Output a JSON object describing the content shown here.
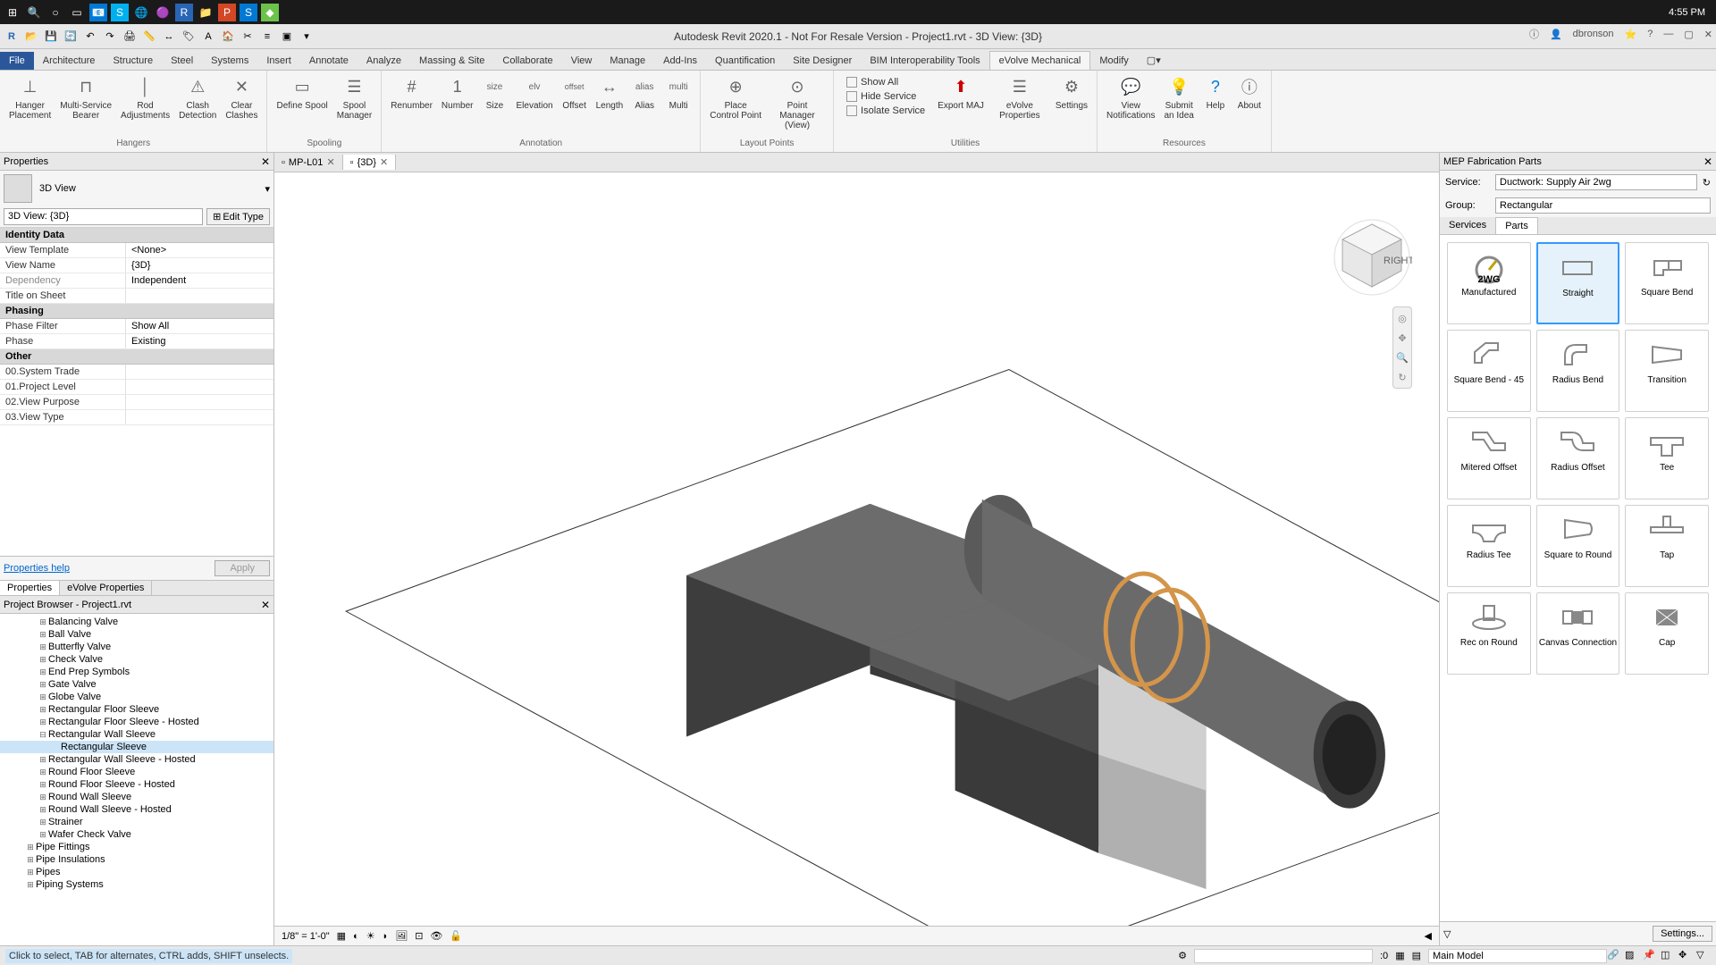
{
  "taskbar": {
    "time": "4:55 PM"
  },
  "app": {
    "title": "Autodesk Revit 2020.1 - Not For Resale Version - Project1.rvt - 3D View: {3D}",
    "user": "dbronson"
  },
  "ribbon": {
    "tabs": [
      "File",
      "Architecture",
      "Structure",
      "Steel",
      "Systems",
      "Insert",
      "Annotate",
      "Analyze",
      "Massing & Site",
      "Collaborate",
      "View",
      "Manage",
      "Add-Ins",
      "Quantification",
      "Site Designer",
      "BIM Interoperability Tools",
      "eVolve Mechanical",
      "Modify"
    ],
    "active_tab": "eVolve Mechanical",
    "groups": {
      "hangers": {
        "label": "Hangers",
        "buttons": [
          "Hanger\nPlacement",
          "Multi-Service\nBearer",
          "Rod\nAdjustments",
          "Clash\nDetection",
          "Clear\nClashes"
        ]
      },
      "spooling": {
        "label": "Spooling",
        "buttons": [
          "Define Spool",
          "Spool\nManager"
        ]
      },
      "annotation": {
        "label": "Annotation",
        "buttons": [
          "Renumber",
          "Number",
          "Size",
          "Elevation",
          "Offset",
          "Length",
          "Alias",
          "Multi"
        ]
      },
      "layout": {
        "label": "Layout Points",
        "buttons": [
          "Place\nControl Point",
          "Point\nManager (View)"
        ]
      },
      "utilities": {
        "label": "Utilities",
        "checks": [
          "Show All",
          "Hide Service",
          "Isolate Service"
        ],
        "buttons": [
          "Export MAJ",
          "eVolve Properties",
          "Settings"
        ]
      },
      "resources": {
        "label": "Resources",
        "buttons": [
          "View\nNotifications",
          "Submit\nan Idea",
          "Help",
          "About"
        ]
      }
    }
  },
  "properties": {
    "panel_title": "Properties",
    "type_name": "3D View",
    "instance_label": "3D View: {3D}",
    "edit_type": "Edit Type",
    "sections": {
      "identity": {
        "title": "Identity Data",
        "rows": [
          {
            "label": "View Template",
            "value": "<None>"
          },
          {
            "label": "View Name",
            "value": "{3D}"
          },
          {
            "label": "Dependency",
            "value": "Independent",
            "grey": true
          },
          {
            "label": "Title on Sheet",
            "value": ""
          }
        ]
      },
      "phasing": {
        "title": "Phasing",
        "rows": [
          {
            "label": "Phase Filter",
            "value": "Show All"
          },
          {
            "label": "Phase",
            "value": "Existing"
          }
        ]
      },
      "other": {
        "title": "Other",
        "rows": [
          {
            "label": "00.System Trade",
            "value": ""
          },
          {
            "label": "01.Project Level",
            "value": ""
          },
          {
            "label": "02.View Purpose",
            "value": ""
          },
          {
            "label": "03.View Type",
            "value": ""
          }
        ]
      }
    },
    "help": "Properties help",
    "apply": "Apply",
    "sub_tabs": [
      "Properties",
      "eVolve Properties"
    ]
  },
  "browser": {
    "title": "Project Browser - Project1.rvt",
    "items": [
      {
        "label": "Balancing Valve",
        "indent": 3
      },
      {
        "label": "Ball Valve",
        "indent": 3
      },
      {
        "label": "Butterfly Valve",
        "indent": 3
      },
      {
        "label": "Check Valve",
        "indent": 3
      },
      {
        "label": "End Prep Symbols",
        "indent": 3
      },
      {
        "label": "Gate Valve",
        "indent": 3
      },
      {
        "label": "Globe Valve",
        "indent": 3
      },
      {
        "label": "Rectangular Floor Sleeve",
        "indent": 3
      },
      {
        "label": "Rectangular Floor Sleeve - Hosted",
        "indent": 3
      },
      {
        "label": "Rectangular Wall Sleeve",
        "indent": 3,
        "expanded": true
      },
      {
        "label": "Rectangular Sleeve",
        "indent": 4,
        "selected": true
      },
      {
        "label": "Rectangular Wall Sleeve - Hosted",
        "indent": 3
      },
      {
        "label": "Round Floor Sleeve",
        "indent": 3
      },
      {
        "label": "Round Floor Sleeve - Hosted",
        "indent": 3
      },
      {
        "label": "Round Wall Sleeve",
        "indent": 3
      },
      {
        "label": "Round Wall Sleeve - Hosted",
        "indent": 3
      },
      {
        "label": "Strainer",
        "indent": 3
      },
      {
        "label": "Wafer Check Valve",
        "indent": 3
      },
      {
        "label": "Pipe Fittings",
        "indent": 2
      },
      {
        "label": "Pipe Insulations",
        "indent": 2
      },
      {
        "label": "Pipes",
        "indent": 2
      },
      {
        "label": "Piping Systems",
        "indent": 2
      }
    ]
  },
  "view_tabs": [
    {
      "label": "MP-L01",
      "active": false
    },
    {
      "label": "{3D}",
      "active": true
    }
  ],
  "view_controls": {
    "scale": "1/8\" = 1'-0\""
  },
  "fabrication": {
    "panel_title": "MEP Fabrication Parts",
    "service_label": "Service:",
    "service_value": "Ductwork: Supply Air   2wg",
    "group_label": "Group:",
    "group_value": "Rectangular",
    "tabs": [
      "Services",
      "Parts"
    ],
    "active_tab": "Parts",
    "parts": [
      {
        "label": "Manufactured",
        "icon": "gauge"
      },
      {
        "label": "Straight",
        "icon": "straight",
        "selected": true
      },
      {
        "label": "Square Bend",
        "icon": "sqbend"
      },
      {
        "label": "Square Bend - 45",
        "icon": "sqbend45"
      },
      {
        "label": "Radius Bend",
        "icon": "radbend"
      },
      {
        "label": "Transition",
        "icon": "transition"
      },
      {
        "label": "Mitered Offset",
        "icon": "mitoffset"
      },
      {
        "label": "Radius Offset",
        "icon": "radoffset"
      },
      {
        "label": "Tee",
        "icon": "tee"
      },
      {
        "label": "Radius Tee",
        "icon": "radtee"
      },
      {
        "label": "Square to Round",
        "icon": "sqround"
      },
      {
        "label": "Tap",
        "icon": "tap"
      },
      {
        "label": "Rec on Round",
        "icon": "reconround"
      },
      {
        "label": "Canvas Connection",
        "icon": "canvas"
      },
      {
        "label": "Cap",
        "icon": "cap"
      }
    ],
    "settings": "Settings..."
  },
  "status": {
    "hint": "Click to select, TAB for alternates, CTRL adds, SHIFT unselects.",
    "worksets": ":0",
    "model": "Main Model"
  }
}
